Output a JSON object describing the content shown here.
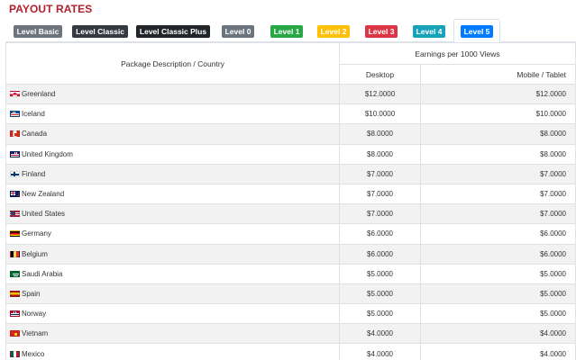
{
  "page": {
    "title": "PAYOUT RATES"
  },
  "tabs": [
    {
      "label": "Level Basic",
      "color": "#6c757d",
      "active": false
    },
    {
      "label": "Level Classic",
      "color": "#343a40",
      "active": false
    },
    {
      "label": "Level Classic Plus",
      "color": "#212529",
      "active": false
    },
    {
      "label": "Level 0",
      "color": "#6c757d",
      "active": false
    },
    {
      "label": "Level 1",
      "color": "#28a745",
      "active": false
    },
    {
      "label": "Level 2",
      "color": "#ffc107",
      "active": false
    },
    {
      "label": "Level 3",
      "color": "#dc3545",
      "active": false
    },
    {
      "label": "Level 4",
      "color": "#17a2b8",
      "active": false
    },
    {
      "label": "Level 5",
      "color": "#007bff",
      "active": true
    }
  ],
  "table": {
    "header_package": "Package Description / Country",
    "header_earnings": "Earnings per 1000 Views",
    "header_desktop": "Desktop",
    "header_mobile": "Mobile / Tablet",
    "rows": [
      {
        "country": "Greenland",
        "flag": "greenland-flag-icon",
        "desktop": "$12.0000",
        "mobile": "$12.0000"
      },
      {
        "country": "Iceland",
        "flag": "iceland-flag-icon",
        "desktop": "$10.0000",
        "mobile": "$10.0000"
      },
      {
        "country": "Canada",
        "flag": "canada-flag-icon",
        "desktop": "$8.0000",
        "mobile": "$8.0000"
      },
      {
        "country": "United Kingdom",
        "flag": "united-kingdom-flag-icon",
        "desktop": "$8.0000",
        "mobile": "$8.0000"
      },
      {
        "country": "Finland",
        "flag": "finland-flag-icon",
        "desktop": "$7.0000",
        "mobile": "$7.0000"
      },
      {
        "country": "New Zealand",
        "flag": "new-zealand-flag-icon",
        "desktop": "$7.0000",
        "mobile": "$7.0000"
      },
      {
        "country": "United States",
        "flag": "united-states-flag-icon",
        "desktop": "$7.0000",
        "mobile": "$7.0000"
      },
      {
        "country": "Germany",
        "flag": "germany-flag-icon",
        "desktop": "$6.0000",
        "mobile": "$6.0000"
      },
      {
        "country": "Belgium",
        "flag": "belgium-flag-icon",
        "desktop": "$6.0000",
        "mobile": "$6.0000"
      },
      {
        "country": "Saudi Arabia",
        "flag": "saudi-arabia-flag-icon",
        "desktop": "$5.0000",
        "mobile": "$5.0000"
      },
      {
        "country": "Spain",
        "flag": "spain-flag-icon",
        "desktop": "$5.0000",
        "mobile": "$5.0000"
      },
      {
        "country": "Norway",
        "flag": "norway-flag-icon",
        "desktop": "$5.0000",
        "mobile": "$5.0000"
      },
      {
        "country": "Vietnam",
        "flag": "vietnam-flag-icon",
        "desktop": "$4.0000",
        "mobile": "$4.0000"
      },
      {
        "country": "Mexico",
        "flag": "mexico-flag-icon",
        "desktop": "$4.0000",
        "mobile": "$4.0000"
      }
    ]
  }
}
